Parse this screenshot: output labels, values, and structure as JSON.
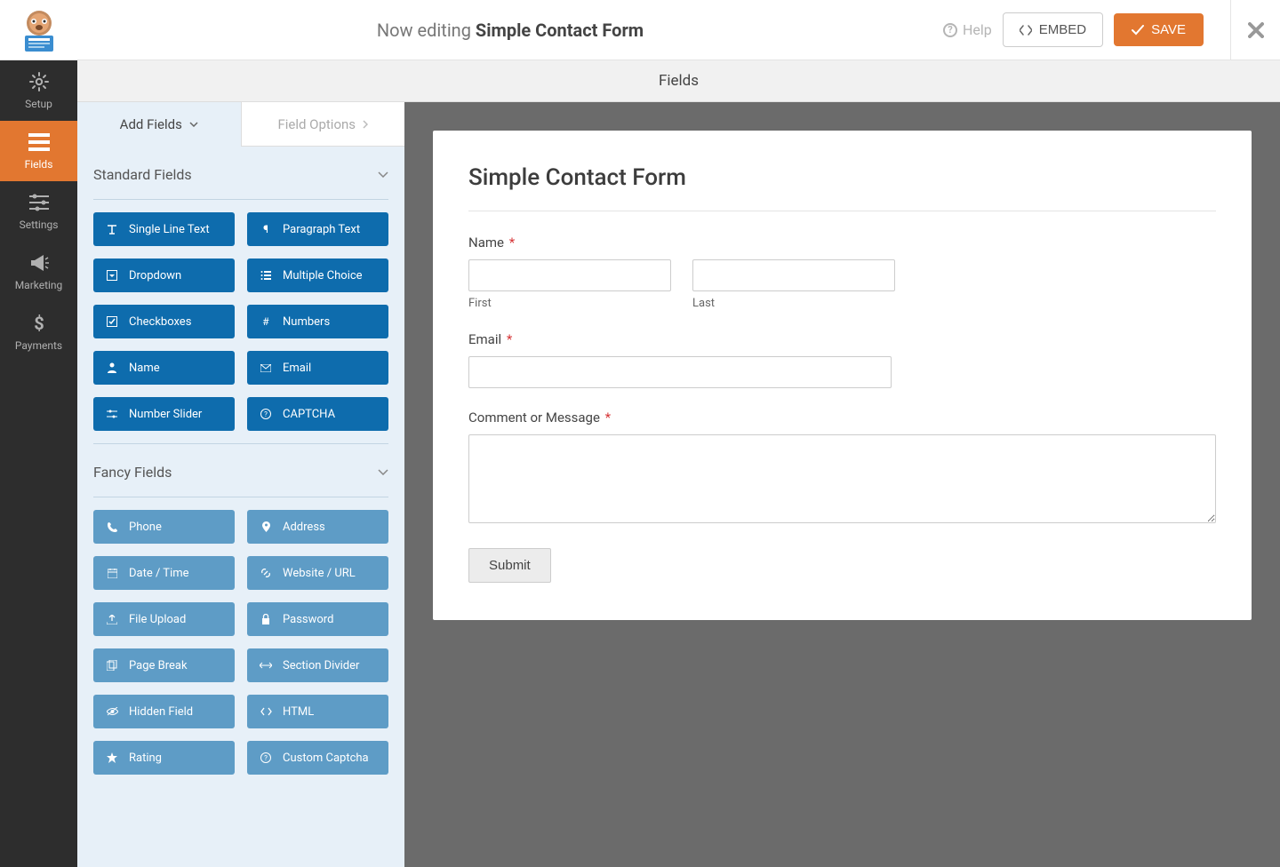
{
  "header": {
    "editing_prefix": "Now editing ",
    "form_name": "Simple Contact Form",
    "help_label": "Help",
    "embed_label": "EMBED",
    "save_label": "SAVE"
  },
  "leftnav": {
    "items": [
      {
        "id": "setup",
        "label": "Setup",
        "icon": "gear"
      },
      {
        "id": "fields",
        "label": "Fields",
        "icon": "list"
      },
      {
        "id": "settings",
        "label": "Settings",
        "icon": "sliders"
      },
      {
        "id": "marketing",
        "label": "Marketing",
        "icon": "bullhorn"
      },
      {
        "id": "payments",
        "label": "Payments",
        "icon": "dollar"
      }
    ],
    "active": "fields"
  },
  "section_header": "Fields",
  "panel": {
    "tabs": [
      {
        "label": "Add Fields",
        "active": true
      },
      {
        "label": "Field Options",
        "active": false
      }
    ],
    "groups": [
      {
        "title": "Standard Fields",
        "dim": false,
        "fields": [
          {
            "label": "Single Line Text",
            "icon": "text"
          },
          {
            "label": "Paragraph Text",
            "icon": "paragraph"
          },
          {
            "label": "Dropdown",
            "icon": "caret-square"
          },
          {
            "label": "Multiple Choice",
            "icon": "list-ul"
          },
          {
            "label": "Checkboxes",
            "icon": "check-square"
          },
          {
            "label": "Numbers",
            "icon": "hash"
          },
          {
            "label": "Name",
            "icon": "user"
          },
          {
            "label": "Email",
            "icon": "envelope"
          },
          {
            "label": "Number Slider",
            "icon": "sliders-h"
          },
          {
            "label": "CAPTCHA",
            "icon": "question-circle"
          }
        ]
      },
      {
        "title": "Fancy Fields",
        "dim": true,
        "fields": [
          {
            "label": "Phone",
            "icon": "phone"
          },
          {
            "label": "Address",
            "icon": "marker"
          },
          {
            "label": "Date / Time",
            "icon": "calendar"
          },
          {
            "label": "Website / URL",
            "icon": "link"
          },
          {
            "label": "File Upload",
            "icon": "upload"
          },
          {
            "label": "Password",
            "icon": "lock"
          },
          {
            "label": "Page Break",
            "icon": "files"
          },
          {
            "label": "Section Divider",
            "icon": "arrows-h"
          },
          {
            "label": "Hidden Field",
            "icon": "eye-slash"
          },
          {
            "label": "HTML",
            "icon": "code"
          },
          {
            "label": "Rating",
            "icon": "star"
          },
          {
            "label": "Custom Captcha",
            "icon": "question-circle"
          }
        ]
      }
    ]
  },
  "preview": {
    "title": "Simple Contact Form",
    "name_label": "Name",
    "first_sub": "First",
    "last_sub": "Last",
    "email_label": "Email",
    "comment_label": "Comment or Message",
    "submit_label": "Submit"
  }
}
